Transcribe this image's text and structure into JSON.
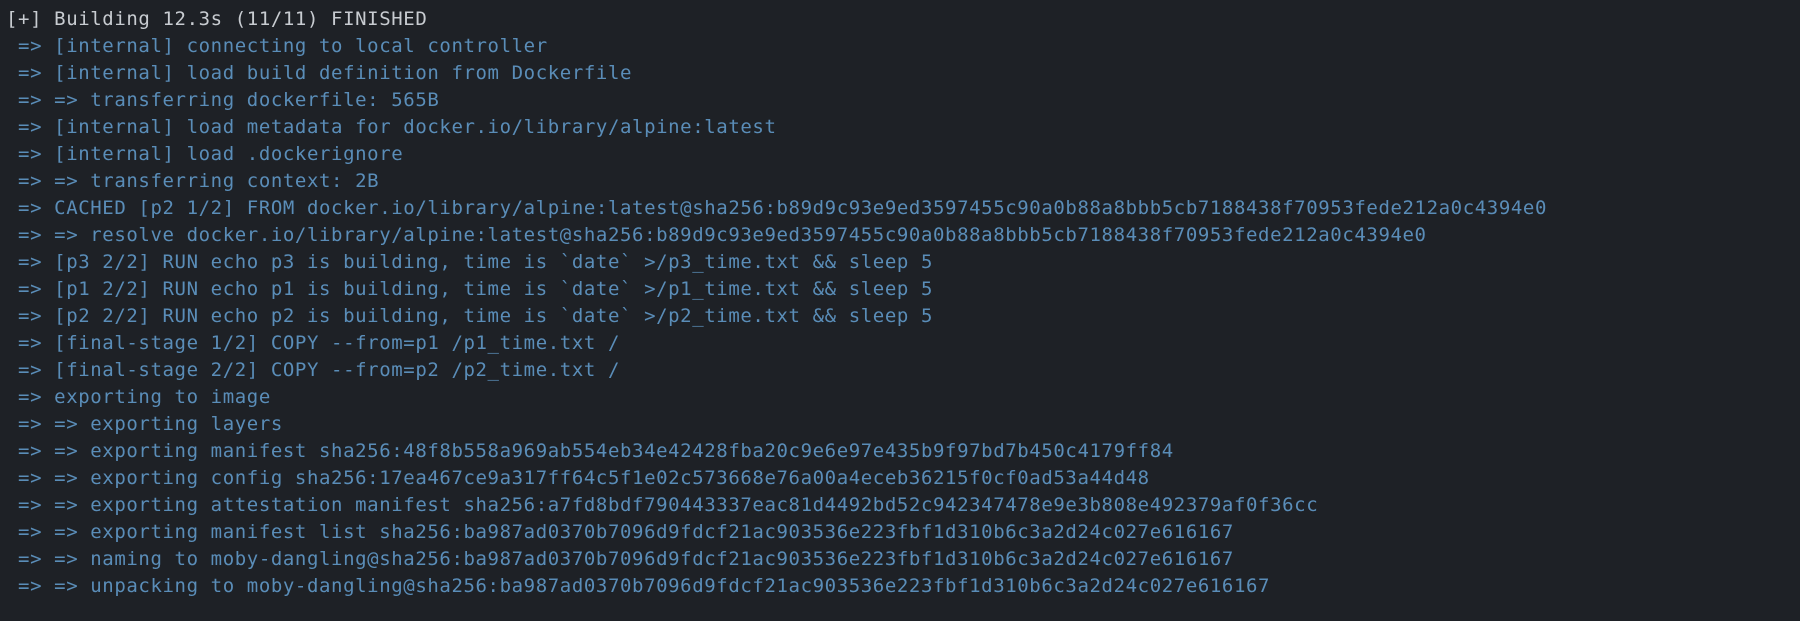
{
  "header": "[+] Building 12.3s (11/11) FINISHED",
  "lines": [
    " => [internal] connecting to local controller",
    " => [internal] load build definition from Dockerfile",
    " => => transferring dockerfile: 565B",
    " => [internal] load metadata for docker.io/library/alpine:latest",
    " => [internal] load .dockerignore",
    " => => transferring context: 2B",
    " => CACHED [p2 1/2] FROM docker.io/library/alpine:latest@sha256:b89d9c93e9ed3597455c90a0b88a8bbb5cb7188438f70953fede212a0c4394e0",
    " => => resolve docker.io/library/alpine:latest@sha256:b89d9c93e9ed3597455c90a0b88a8bbb5cb7188438f70953fede212a0c4394e0",
    " => [p3 2/2] RUN echo p3 is building, time is `date` >/p3_time.txt && sleep 5",
    " => [p1 2/2] RUN echo p1 is building, time is `date` >/p1_time.txt && sleep 5",
    " => [p2 2/2] RUN echo p2 is building, time is `date` >/p2_time.txt && sleep 5",
    " => [final-stage 1/2] COPY --from=p1 /p1_time.txt /",
    " => [final-stage 2/2] COPY --from=p2 /p2_time.txt /",
    " => exporting to image",
    " => => exporting layers",
    " => => exporting manifest sha256:48f8b558a969ab554eb34e42428fba20c9e6e97e435b9f97bd7b450c4179ff84",
    " => => exporting config sha256:17ea467ce9a317ff64c5f1e02c573668e76a00a4eceb36215f0cf0ad53a44d48",
    " => => exporting attestation manifest sha256:a7fd8bdf790443337eac81d4492bd52c942347478e9e3b808e492379af0f36cc",
    " => => exporting manifest list sha256:ba987ad0370b7096d9fdcf21ac903536e223fbf1d310b6c3a2d24c027e616167",
    " => => naming to moby-dangling@sha256:ba987ad0370b7096d9fdcf21ac903536e223fbf1d310b6c3a2d24c027e616167",
    " => => unpacking to moby-dangling@sha256:ba987ad0370b7096d9fdcf21ac903536e223fbf1d310b6c3a2d24c027e616167"
  ]
}
